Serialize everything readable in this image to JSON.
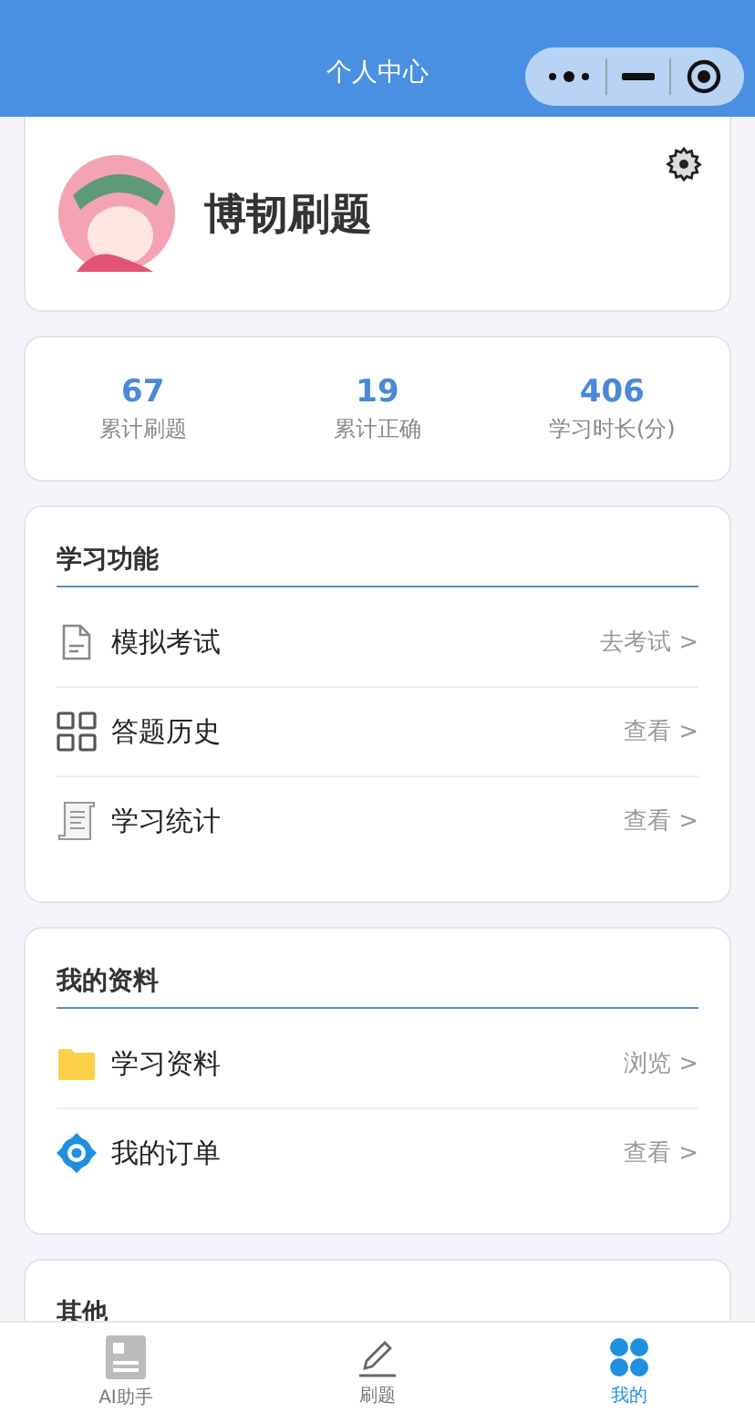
{
  "header": {
    "title": "个人中心"
  },
  "profile": {
    "name": "博韧刷题"
  },
  "stats": [
    {
      "value": "67",
      "label": "累计刷题"
    },
    {
      "value": "19",
      "label": "累计正确"
    },
    {
      "value": "406",
      "label": "学习时长(分)"
    }
  ],
  "sections": [
    {
      "title": "学习功能",
      "items": [
        {
          "label": "模拟考试",
          "action": "去考试 >"
        },
        {
          "label": "答题历史",
          "action": "查看 >"
        },
        {
          "label": "学习统计",
          "action": "查看 >"
        }
      ]
    },
    {
      "title": "我的资料",
      "items": [
        {
          "label": "学习资料",
          "action": "浏览 >"
        },
        {
          "label": "我的订单",
          "action": "查看 >"
        }
      ]
    },
    {
      "title": "其他"
    }
  ],
  "tabbar": [
    {
      "label": "AI助手",
      "selected": false
    },
    {
      "label": "刷题",
      "selected": false
    },
    {
      "label": "我的",
      "selected": true
    }
  ]
}
